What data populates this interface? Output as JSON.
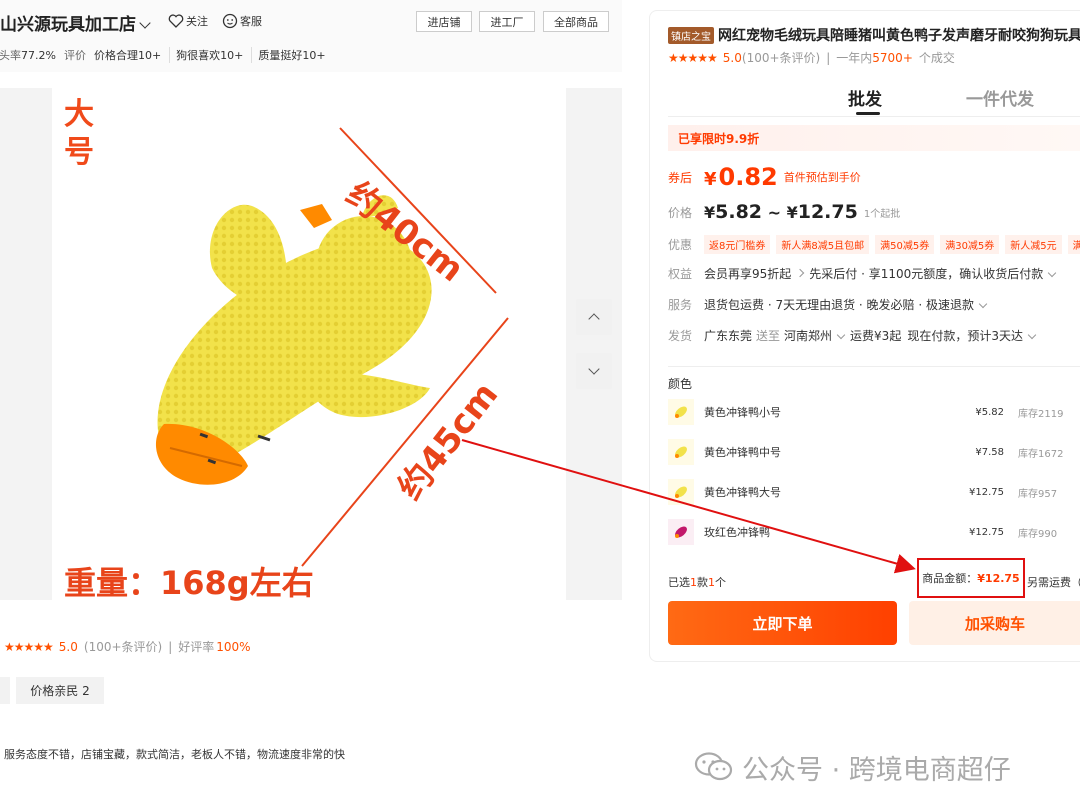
{
  "store": {
    "name": "山兴源玩具加工店",
    "follow_label": "关注",
    "service_label": "客服",
    "buttons": [
      "进店铺",
      "进工厂",
      "全部商品"
    ],
    "stats": {
      "repeat_rate_label": "回头率",
      "repeat_rate_value": "77.2%",
      "review_label": "评价",
      "tags": [
        "价格合理10+",
        "狗很喜欢10+",
        "质量挺好10+"
      ]
    }
  },
  "main_image": {
    "size_badge": "大号",
    "dimension_a": "约40cm",
    "dimension_b": "约45cm",
    "weight": "重量：168g左右"
  },
  "reviews": {
    "stars": "★★★★★",
    "score": "5.0",
    "count": "(100+条评价)",
    "sep": "|",
    "good_rate_label": "好评率",
    "good_rate_value": "100%",
    "tags": [
      "价格亲民 2"
    ],
    "sample": "服务态度不错，店铺宝藏，款式简洁，老板人不错，物流速度非常的快"
  },
  "product": {
    "badge": "镇店之宝",
    "title": "网红宠物毛绒玩具陪睡猪叫黄色鸭子发声磨牙耐咬狗狗玩具",
    "stars": "★★★★★",
    "rating": "5.0",
    "rating_count": "(100+条评价)",
    "sep": "|",
    "sales_label": "一年内",
    "sales_value": "5700+",
    "sales_suffix": "个成交"
  },
  "tabs": [
    "批发",
    "一件代发"
  ],
  "promo_banner": "已享限时9.9折",
  "coupon": {
    "label": "券后",
    "symbol": "¥",
    "price": "0.82",
    "note": "首件预估到手价"
  },
  "price": {
    "label": "价格",
    "low_symbol": "¥",
    "low": "5.82",
    "tilde": "~",
    "high_symbol": "¥",
    "high": "12.75",
    "moq": "1个起批"
  },
  "discounts": {
    "label": "优惠",
    "chips": [
      "返8元门槛券",
      "新人满8减5且包邮",
      "满50减5券",
      "满30减5券",
      "新人减5元",
      "满"
    ]
  },
  "benefits": {
    "label": "权益",
    "text": "会员再享95折起",
    "text2": "先采后付 · 享1100元额度，确认收货后付款"
  },
  "services": {
    "label": "服务",
    "text": "退货包运费 · 7天无理由退货 · 晚发必赔 · 极速退款"
  },
  "shipping": {
    "label": "发货",
    "from": "广东东莞",
    "to_label": "送至",
    "to": "河南郑州",
    "fee": "运费¥3起",
    "eta": "现在付款，预计3天达"
  },
  "color_label": "颜色",
  "skus": [
    {
      "name": "黄色冲锋鸭小号",
      "price": "¥5.82",
      "stock": "库存2119"
    },
    {
      "name": "黄色冲锋鸭中号",
      "price": "¥7.58",
      "stock": "库存1672"
    },
    {
      "name": "黄色冲锋鸭大号",
      "price": "¥12.75",
      "stock": "库存957"
    },
    {
      "name": "玫红色冲锋鸭",
      "price": "¥12.75",
      "stock": "库存990"
    }
  ],
  "summary": {
    "selected_prefix": "已选",
    "kinds": "1",
    "kinds_unit": "款",
    "qty": "1",
    "qty_unit": "个",
    "total_label": "商品金额：",
    "total_value": "¥12.75",
    "ship_note": "另需运费（"
  },
  "actions": {
    "buy": "立即下单",
    "cart": "加采购车"
  },
  "watermark": {
    "text": "公众号 · 跨境电商超仔"
  },
  "colors": {
    "accent": "#ff5000",
    "price_red": "#ff3a00",
    "highlight_box": "#e01010",
    "duck_yellow": "#f2e24a",
    "duck_orange": "#ff8a00"
  }
}
